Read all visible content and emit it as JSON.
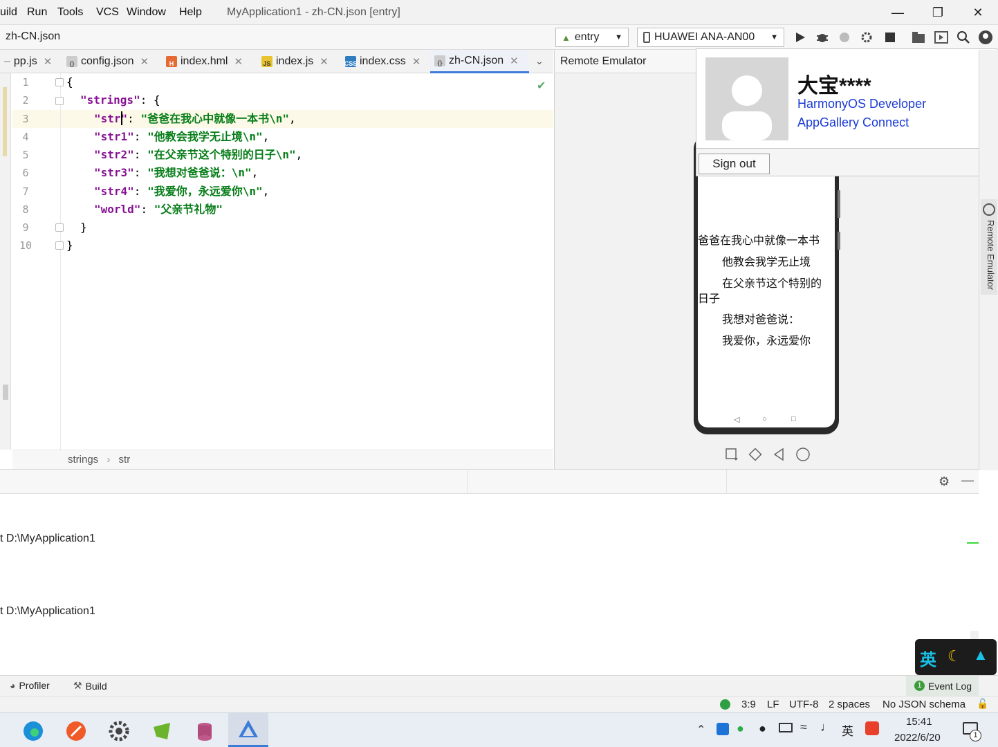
{
  "menubar": {
    "items": [
      {
        "label": "uild"
      },
      {
        "label": "Run"
      },
      {
        "label": "Tools"
      },
      {
        "label": "VCS"
      },
      {
        "label": "Window"
      },
      {
        "label": "Help"
      }
    ],
    "window_title": "MyApplication1 - zh-CN.json [entry]"
  },
  "navbar": {
    "breadcrumb": "zh-CN.json",
    "module_select": "entry",
    "device_select": "HUAWEI ANA-AN00"
  },
  "editor_tabs": [
    {
      "label": "pp.js",
      "icon": "js-file-icon"
    },
    {
      "label": "config.json",
      "icon": "json-file-icon"
    },
    {
      "label": "index.hml",
      "icon": "hml-file-icon"
    },
    {
      "label": "index.js",
      "icon": "js-file-icon"
    },
    {
      "label": "index.css",
      "icon": "css-file-icon"
    },
    {
      "label": "zh-CN.json",
      "icon": "json-file-icon",
      "active": true
    }
  ],
  "editor": {
    "line_numbers": [
      "1",
      "2",
      "3",
      "4",
      "5",
      "6",
      "7",
      "8",
      "9",
      "10"
    ],
    "lines": [
      {
        "open": "{"
      },
      {
        "key": "\"strings\"",
        "sep": ": {"
      },
      {
        "key": "\"str\"",
        "sep": ": ",
        "value": "\"爸爸在我心中就像一本书\\n\"",
        "end": ","
      },
      {
        "key": "\"str1\"",
        "sep": ": ",
        "value": "\"他教会我学无止境\\n\"",
        "end": ","
      },
      {
        "key": "\"str2\"",
        "sep": ": ",
        "value": "\"在父亲节这个特别的日子\\n\"",
        "end": ","
      },
      {
        "key": "\"str3\"",
        "sep": ": ",
        "value": "\"我想对爸爸说：\\n\"",
        "end": ","
      },
      {
        "key": "\"str4\"",
        "sep": ": ",
        "value": "\"我爱你，永远爱你\\n\"",
        "end": ","
      },
      {
        "key": "\"world\"",
        "sep": ": ",
        "value": "\"父亲节礼物\"",
        "end": ""
      },
      {
        "open": "}"
      },
      {
        "open": "}"
      }
    ],
    "breadcrumb": [
      "strings",
      "str"
    ]
  },
  "emulator": {
    "title": "Remote Emulator",
    "side_label": "Remote Emulator",
    "screen_lines": [
      "爸爸在我心中就像一本书",
      "他教会我学无止境",
      "在父亲节这个特别的",
      "日子",
      "我想对爸爸说：",
      "我爱你，永远爱你"
    ]
  },
  "account_popup": {
    "name": "大宝****",
    "link1": "HarmonyOS Developer",
    "link2": "AppGallery Connect",
    "sign_out": "Sign out"
  },
  "console": {
    "lines": [
      "t D:\\MyApplication1",
      "t D:\\MyApplication1"
    ]
  },
  "tool_windows": {
    "profiler": "Profiler",
    "build": "Build",
    "event_log": "Event Log",
    "event_count": "1"
  },
  "status": {
    "position": "3:9",
    "line_sep": "LF",
    "encoding": "UTF-8",
    "indent": "2 spaces",
    "schema": "No JSON schema"
  },
  "ime": {
    "lang": "英"
  },
  "taskbar": {
    "tray_lang": "英",
    "time": "15:41",
    "date": "2022/6/20",
    "notif_count": "1"
  },
  "colors": {
    "accent": "#3d7bd9",
    "json_key": "#871094",
    "json_string": "#067d17",
    "link": "#1a3bd6"
  }
}
